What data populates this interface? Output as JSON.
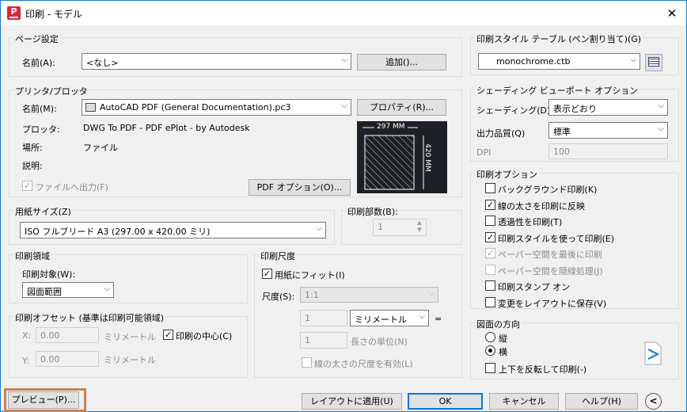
{
  "titlebar": {
    "app_icon_letter": "P",
    "title": "印刷 - モデル",
    "close_glyph": "✕"
  },
  "page_setup": {
    "group": "ページ設定",
    "name_label": "名前(A):",
    "name_value": "<なし>",
    "add_button": "追加()..."
  },
  "printer": {
    "group": "プリンタ/プロッタ",
    "name_label": "名前(M):",
    "name_value": "AutoCAD PDF (General Documentation).pc3",
    "properties_button": "プロパティ(R)...",
    "plotter_label": "プロッタ:",
    "plotter_value": "DWG To PDF - PDF ePlot - by Autodesk",
    "location_label": "場所:",
    "location_value": "ファイル",
    "description_label": "説明:",
    "print_to_file": "ファイルへ出力(F)",
    "print_to_file_checked": true,
    "pdf_options_button": "PDF オプション(O)...",
    "preview_width": "297 MM",
    "preview_height": "420 MM"
  },
  "paper_size": {
    "group": "用紙サイズ(Z)",
    "value": "ISO フルブリード A3 (297.00 x 420.00 ミリ)"
  },
  "copies": {
    "group": "印刷部数(B):",
    "value": "1"
  },
  "plot_area": {
    "group": "印刷領域",
    "what_label": "印刷対象(W):",
    "what_value": "図面範囲"
  },
  "plot_offset": {
    "group": "印刷オフセット (基準は印刷可能領域)",
    "x_label": "X:",
    "x_value": "0.00",
    "x_unit": "ミリメートル",
    "y_label": "Y:",
    "y_value": "0.00",
    "y_unit": "ミリメートル",
    "center": "印刷の中心(C)",
    "center_checked": true
  },
  "plot_scale": {
    "group": "印刷尺度",
    "fit": "用紙にフィット(I)",
    "fit_checked": true,
    "scale_label": "尺度(S):",
    "scale_value": "1:1",
    "val1": "1",
    "unit_value": "ミリメートル",
    "equals": "=",
    "val2": "1",
    "unit2": "長さの単位(N)",
    "lineweights": "線の太さの尺度を有効(L)",
    "lineweights_checked": false
  },
  "plot_style": {
    "group": "印刷スタイル テーブル (ペン割り当て)(G)",
    "value": "monochrome.ctb"
  },
  "shaded": {
    "group": "シェーディング ビューポート オプション",
    "shade_label": "シェーディング(D)",
    "shade_value": "表示どおり",
    "quality_label": "出力品質(Q)",
    "quality_value": "標準",
    "dpi_label": "DPI",
    "dpi_value": "100"
  },
  "plot_options": {
    "group": "印刷オプション",
    "items": [
      {
        "label": "バックグラウンド印刷(K)",
        "checked": false,
        "disabled": false
      },
      {
        "label": "線の太さを印刷に反映",
        "checked": true,
        "disabled": false
      },
      {
        "label": "透過性を印刷(T)",
        "checked": false,
        "disabled": false
      },
      {
        "label": "印刷スタイルを使って印刷(E)",
        "checked": true,
        "disabled": false
      },
      {
        "label": "ペーパー空間を最後に印刷",
        "checked": true,
        "disabled": true
      },
      {
        "label": "ペーパー空間を隠線処理(J)",
        "checked": false,
        "disabled": true
      },
      {
        "label": "印刷スタンプ オン",
        "checked": false,
        "disabled": false
      },
      {
        "label": "変更をレイアウトに保存(V)",
        "checked": false,
        "disabled": false
      }
    ]
  },
  "orientation": {
    "group": "図面の方向",
    "portrait": "縦",
    "landscape": "横",
    "selected": "landscape",
    "upside_down": "上下を反転して印刷(-)",
    "upside_down_checked": false
  },
  "buttons": {
    "preview": "プレビュー(P)...",
    "apply": "レイアウトに適用(U)",
    "ok": "OK",
    "cancel": "キャンセル",
    "help": "ヘルプ(H)",
    "collapse": "<"
  },
  "colors": {
    "accent": "#0078d7",
    "highlight_border": "#c8825a",
    "preview_bg": "#1d2025",
    "title_icon": "#d6263d"
  }
}
